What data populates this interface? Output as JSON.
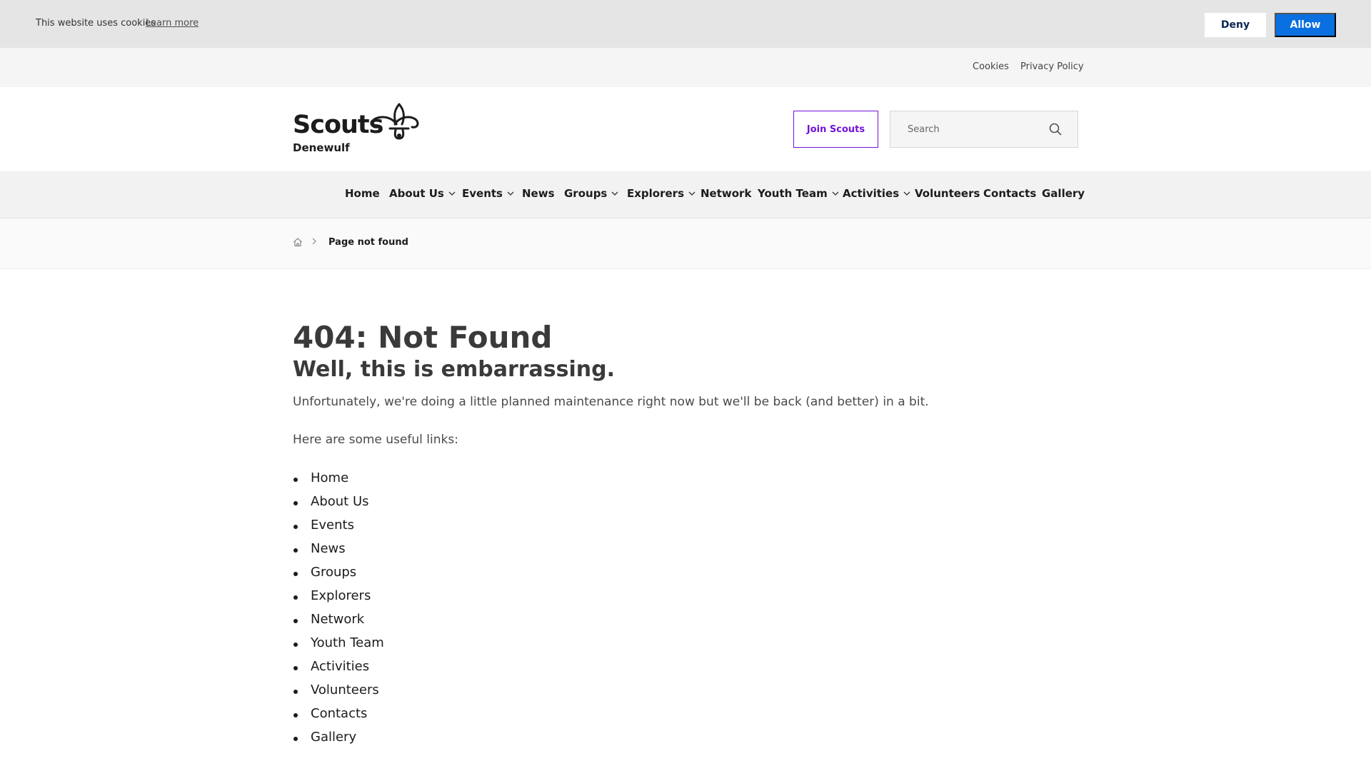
{
  "cookie": {
    "text": "This website uses cookies",
    "learn_more": "Learn more",
    "deny": "Deny",
    "allow": "Allow"
  },
  "utility": {
    "cookies": "Cookies",
    "privacy": "Privacy Policy"
  },
  "header": {
    "logo_word": "Scouts",
    "logo_sub": "Denewulf",
    "join": "Join Scouts",
    "search_placeholder": "Search"
  },
  "nav": {
    "items": [
      {
        "label": "Home",
        "dropdown": false
      },
      {
        "label": "About Us",
        "dropdown": true
      },
      {
        "label": "Events",
        "dropdown": true
      },
      {
        "label": "News",
        "dropdown": false
      },
      {
        "label": "Groups",
        "dropdown": true
      },
      {
        "label": "Explorers",
        "dropdown": true
      },
      {
        "label": "Network",
        "dropdown": false
      },
      {
        "label": "Youth Team",
        "dropdown": true
      },
      {
        "label": "Activities",
        "dropdown": true
      },
      {
        "label": "Volunteers",
        "dropdown": false
      },
      {
        "label": "Contacts",
        "dropdown": false
      },
      {
        "label": "Gallery",
        "dropdown": false
      }
    ]
  },
  "breadcrumb": {
    "current": "Page not found"
  },
  "content": {
    "title": "404: Not Found",
    "subtitle": "Well, this is embarrassing.",
    "message": "Unfortunately, we're doing a little planned maintenance right now but we'll be back (and better) in a bit.",
    "links_intro": "Here are some useful links:",
    "links": [
      "Home",
      "About Us",
      "Events",
      "News",
      "Groups",
      "Explorers",
      "Network",
      "Youth Team",
      "Activities",
      "Volunteers",
      "Contacts",
      "Gallery"
    ]
  },
  "colors": {
    "brand_purple": "#7413dc",
    "allow_blue": "#0a6fe0"
  }
}
